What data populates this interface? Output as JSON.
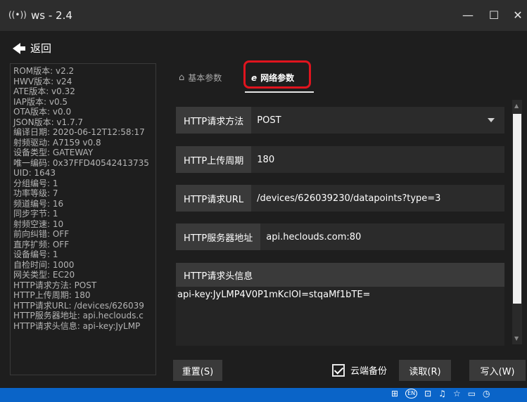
{
  "window": {
    "app_icon": "((•))",
    "title": "ws - 2.4",
    "minimize": "—",
    "maximize": "☐",
    "close": "✕"
  },
  "nav": {
    "back_label": "返回"
  },
  "info_lines": [
    "ROM版本: v2.2",
    "HWV版本: v24",
    "ATE版本: v0.32",
    "IAP版本: v0.5",
    "OTA版本: v0.0",
    "JSON版本: v1.7.7",
    "编译日期: 2020-06-12T12:58:17",
    "射频驱动: A7159 v0.8",
    "设备类型: GATEWAY",
    "唯一编码: 0x37FFD40542413735",
    "UID: 1643",
    "分组编号: 1",
    "功率等级: 7",
    "频道编号: 16",
    "同步字节: 1",
    "射频空速: 10",
    "前向纠错: OFF",
    "直序扩频: OFF",
    "设备编号: 1",
    "自检时间: 1000",
    "网关类型: EC20",
    "HTTP请求方法: POST",
    "HTTP上传周期: 180",
    "HTTP请求URL: /devices/626039",
    "HTTP服务器地址: api.heclouds.c",
    "HTTP请求头信息: api-key:JyLMP"
  ],
  "tabs": {
    "basic": {
      "icon": "⌂",
      "label": "基本参数"
    },
    "network": {
      "icon": "e",
      "label": "网络参数"
    }
  },
  "form": {
    "method": {
      "label": "HTTP请求方法",
      "value": "POST"
    },
    "period": {
      "label": "HTTP上传周期",
      "value": "180"
    },
    "url": {
      "label": "HTTP请求URL",
      "value": "/devices/626039230/datapoints?type=3"
    },
    "server": {
      "label": "HTTP服务器地址",
      "value": "api.heclouds.com:80"
    },
    "headers": {
      "label": "HTTP请求头信息",
      "value": "api-key:JyLMP4V0P1mKclOI=stqaMf1bTE="
    }
  },
  "actions": {
    "reset": "重置(S)",
    "cloud_backup": "云端备份",
    "read": "读取(R)",
    "write": "写入(W)"
  },
  "tray": {
    "icons": [
      "⊞",
      "EN",
      "⊡",
      "♫",
      "☆",
      "▭",
      "◷"
    ],
    "input_method": "EN"
  },
  "colors": {
    "highlight": "#e0141e",
    "taskbar": "#0a64c8"
  }
}
